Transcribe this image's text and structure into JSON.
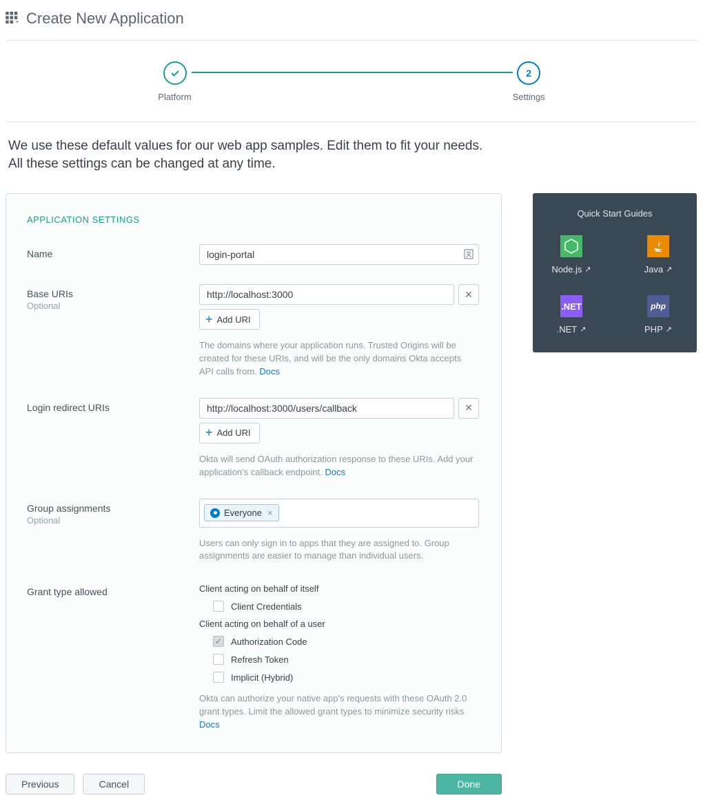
{
  "header": {
    "title": "Create New Application"
  },
  "stepper": {
    "step1": {
      "label": "Platform"
    },
    "step2": {
      "label": "Settings",
      "number": "2"
    }
  },
  "intro": {
    "line1": "We use these default values for our web app samples. Edit them to fit your needs.",
    "line2": "All these settings can be changed at any time."
  },
  "settings": {
    "section_title": "APPLICATION SETTINGS",
    "name": {
      "label": "Name",
      "value": "login-portal"
    },
    "base_uris": {
      "label": "Base URIs",
      "sublabel": "Optional",
      "value": "http://localhost:3000",
      "add_label": "Add URI",
      "help": "The domains where your application runs. Trusted Origins will be created for these URIs, and will be the only domains Okta accepts API calls from.",
      "docs_label": "Docs"
    },
    "login_redirect": {
      "label": "Login redirect URIs",
      "value": "http://localhost:3000/users/callback",
      "add_label": "Add URI",
      "help": "Okta will send OAuth authorization response to these URIs. Add your application's callback endpoint.",
      "docs_label": "Docs"
    },
    "groups": {
      "label": "Group assignments",
      "sublabel": "Optional",
      "chip": "Everyone",
      "help": "Users can only sign in to apps that they are assigned to. Group assignments are easier to manage than individual users."
    },
    "grant": {
      "label": "Grant type allowed",
      "itself_heading": "Client acting on behalf of itself",
      "client_credentials": "Client Credentials",
      "user_heading": "Client acting on behalf of a user",
      "authorization_code": "Authorization Code",
      "refresh_token": "Refresh Token",
      "implicit": "Implicit (Hybrid)",
      "help": "Okta can authorize your native app's requests with these OAuth 2.0 grant types. Limit the allowed grant types to minimize security risks",
      "docs_label": "Docs"
    }
  },
  "guides": {
    "title": "Quick Start Guides",
    "node": "Node.js",
    "java": "Java",
    "dotnet": ".NET",
    "php": "PHP"
  },
  "footer": {
    "previous": "Previous",
    "cancel": "Cancel",
    "done": "Done"
  }
}
